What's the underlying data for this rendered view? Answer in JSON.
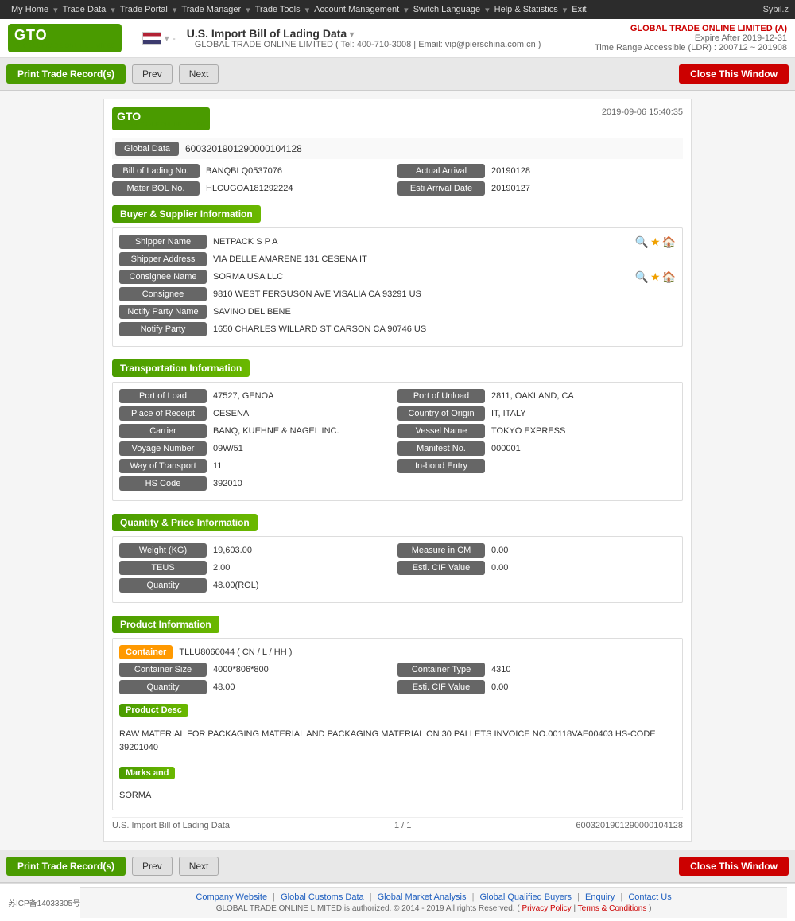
{
  "nav": {
    "items": [
      "My Home",
      "Trade Data",
      "Trade Portal",
      "Trade Manager",
      "Trade Tools",
      "Account Management",
      "Switch Language",
      "Help & Statistics",
      "Exit"
    ],
    "username": "Sybil.z"
  },
  "header": {
    "title": "U.S. Import Bill of Lading Data",
    "title_arrow": "▾",
    "company_name": "GLOBAL TRADE ONLINE LIMITED (A)",
    "expire_label": "Expire After 2019-12-31",
    "time_range": "Time Range Accessible (LDR) : 200712 ~ 201908",
    "tel": "Tel: 400-710-3008",
    "email": "Email: vip@pierschina.com.cn",
    "contact_company": "GLOBAL TRADE ONLINE LIMITED"
  },
  "toolbar": {
    "print_label": "Print Trade Record(s)",
    "prev_label": "Prev",
    "next_label": "Next",
    "close_label": "Close This Window"
  },
  "record": {
    "datetime": "2019-09-06 15:40:35",
    "global_data_label": "Global Data",
    "global_data_value": "6003201901290000104128",
    "bol_label": "Bill of Lading No.",
    "bol_value": "BANQBLQ0537076",
    "actual_arrival_label": "Actual Arrival",
    "actual_arrival_value": "20190128",
    "mater_bol_label": "Mater BOL No.",
    "mater_bol_value": "HLCUGOA181292224",
    "esti_arrival_label": "Esti Arrival Date",
    "esti_arrival_value": "20190127"
  },
  "buyer_supplier": {
    "section_title": "Buyer & Supplier Information",
    "shipper_name_label": "Shipper Name",
    "shipper_name_value": "NETPACK S P A",
    "shipper_address_label": "Shipper Address",
    "shipper_address_value": "VIA DELLE AMARENE 131 CESENA IT",
    "consignee_name_label": "Consignee Name",
    "consignee_name_value": "SORMA USA LLC",
    "consignee_label": "Consignee",
    "consignee_value": "9810 WEST FERGUSON AVE VISALIA CA 93291 US",
    "notify_party_name_label": "Notify Party Name",
    "notify_party_name_value": "SAVINO DEL BENE",
    "notify_party_label": "Notify Party",
    "notify_party_value": "1650 CHARLES WILLARD ST CARSON CA 90746 US"
  },
  "transportation": {
    "section_title": "Transportation Information",
    "port_load_label": "Port of Load",
    "port_load_value": "47527, GENOA",
    "port_unload_label": "Port of Unload",
    "port_unload_value": "2811, OAKLAND, CA",
    "place_receipt_label": "Place of Receipt",
    "place_receipt_value": "CESENA",
    "country_origin_label": "Country of Origin",
    "country_origin_value": "IT, ITALY",
    "carrier_label": "Carrier",
    "carrier_value": "BANQ, KUEHNE & NAGEL INC.",
    "vessel_name_label": "Vessel Name",
    "vessel_name_value": "TOKYO EXPRESS",
    "voyage_number_label": "Voyage Number",
    "voyage_number_value": "09W/51",
    "manifest_no_label": "Manifest No.",
    "manifest_no_value": "000001",
    "way_of_transport_label": "Way of Transport",
    "way_of_transport_value": "11",
    "inbond_entry_label": "In-bond Entry",
    "inbond_entry_value": "",
    "hs_code_label": "HS Code",
    "hs_code_value": "392010"
  },
  "quantity_price": {
    "section_title": "Quantity & Price Information",
    "weight_label": "Weight (KG)",
    "weight_value": "19,603.00",
    "measure_label": "Measure in CM",
    "measure_value": "0.00",
    "teus_label": "TEUS",
    "teus_value": "2.00",
    "esti_cif_label": "Esti. CIF Value",
    "esti_cif_value": "0.00",
    "quantity_label": "Quantity",
    "quantity_value": "48.00(ROL)"
  },
  "product": {
    "section_title": "Product Information",
    "container_badge": "Container",
    "container_value": "TLLU8060044 ( CN / L / HH )",
    "container_size_label": "Container Size",
    "container_size_value": "4000*806*800",
    "container_type_label": "Container Type",
    "container_type_value": "4310",
    "quantity_label": "Quantity",
    "quantity_value": "48.00",
    "esti_cif_label": "Esti. CIF Value",
    "esti_cif_value": "0.00",
    "product_desc_badge": "Product Desc",
    "product_desc_value": "RAW MATERIAL FOR PACKAGING MATERIAL AND PACKAGING MATERIAL ON 30 PALLETS INVOICE NO.00118VAE00403 HS-CODE 39201040",
    "marks_badge": "Marks and",
    "marks_value": "SORMA"
  },
  "record_footer": {
    "source": "U.S. Import Bill of Lading Data",
    "pagination": "1 / 1",
    "record_id": "6003201901290000104128"
  },
  "footer": {
    "icp": "苏ICP备14033305号",
    "links": [
      "Company Website",
      "Global Customs Data",
      "Global Market Analysis",
      "Global Qualified Buyers",
      "Enquiry",
      "Contact Us"
    ],
    "copyright": "GLOBAL TRADE ONLINE LIMITED is authorized. © 2014 - 2019 All rights Reserved.",
    "privacy_policy": "Privacy Policy",
    "terms": "Terms & Conditions"
  }
}
